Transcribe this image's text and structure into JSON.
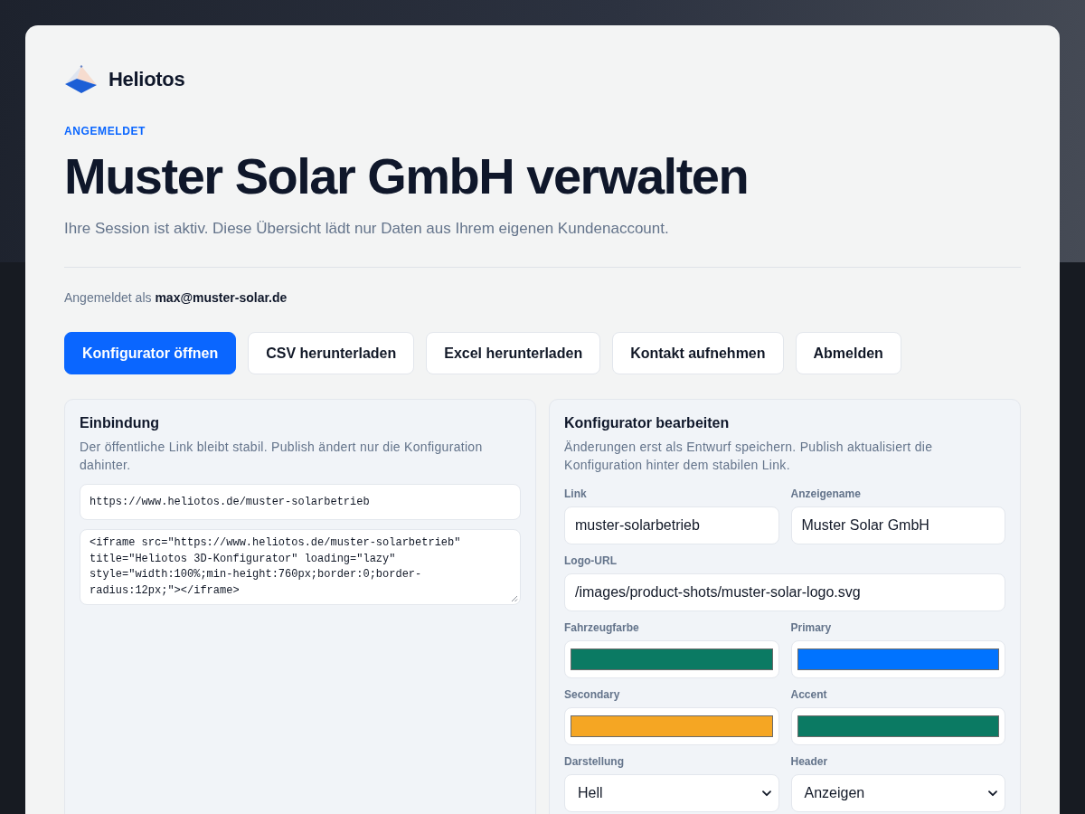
{
  "brand": {
    "name": "Heliotos"
  },
  "header": {
    "eyebrow": "ANGEMELDET",
    "title": "Muster Solar GmbH verwalten",
    "subtitle": "Ihre Session ist aktiv. Diese Übersicht lädt nur Daten aus Ihrem eigenen Kundenaccount."
  },
  "signed_in": "Angemeldet als **max@muster-solar.de**",
  "actions": [
    {
      "label": "Konfigurator öffnen",
      "kind": "primary"
    },
    {
      "label": "CSV herunterladen",
      "kind": "secondary"
    },
    {
      "label": "Excel herunterladen",
      "kind": "secondary"
    },
    {
      "label": "Kontakt aufnehmen",
      "kind": "secondary"
    },
    {
      "label": "Abmelden",
      "kind": "secondary"
    }
  ],
  "embed_panel": {
    "title": "Einbindung",
    "description": "Der öffentliche Link bleibt stabil. Publish ändert nur die Konfiguration dahinter.",
    "link_value": "https://www.heliotos.de/muster-solarbetrieb",
    "embed_code": "<iframe src=\"https://www.heliotos.de/muster-solarbetrieb\" title=\"Heliotos 3D-Konfigurator\" loading=\"lazy\" style=\"width:100%;min-height:760px;border:0;border-radius:12px;\"></iframe>"
  },
  "editor_panel": {
    "title": "Konfigurator bearbeiten",
    "description": "Änderungen erst als Entwurf speichern. Publish aktualisiert die Konfiguration hinter dem stabilen Link.",
    "field_rows": [
      [
        {
          "label": "Link",
          "kind": "text",
          "value": "muster-solarbetrieb"
        },
        {
          "label": "Anzeigename",
          "kind": "text",
          "value": "Muster Solar GmbH"
        }
      ],
      [
        {
          "label": "Logo-URL",
          "kind": "text",
          "value": "/images/product-shots/muster-solar-logo.svg"
        }
      ],
      [
        {
          "label": "Fahrzeugfarbe",
          "kind": "color",
          "color": "#0b7a63"
        },
        {
          "label": "Primary",
          "kind": "color",
          "color": "#0073ff"
        }
      ],
      [
        {
          "label": "Secondary",
          "kind": "color",
          "color": "#f5a623"
        },
        {
          "label": "Accent",
          "kind": "color",
          "color": "#0b7a63"
        }
      ],
      [
        {
          "label": "Darstellung",
          "kind": "select",
          "value": "Hell"
        },
        {
          "label": "Header",
          "kind": "select",
          "value": "Anzeigen"
        }
      ]
    ]
  }
}
